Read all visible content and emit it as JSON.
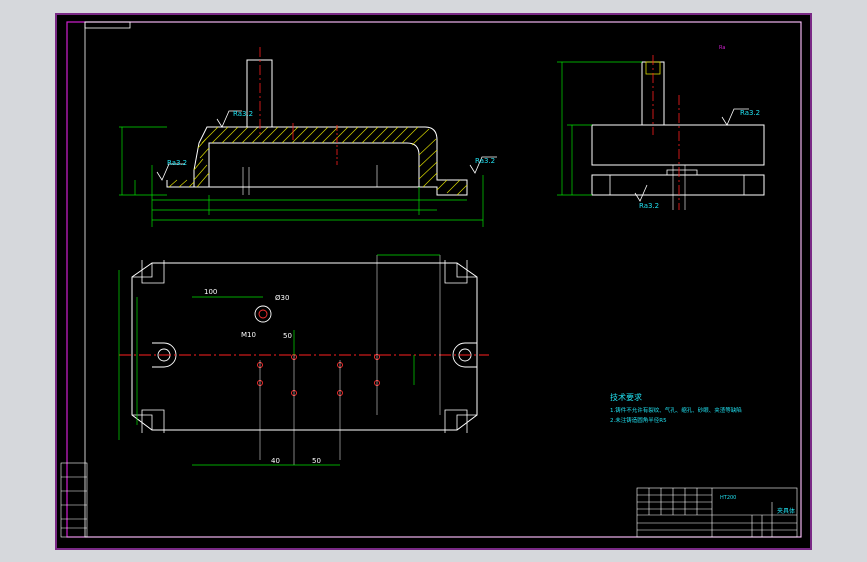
{
  "colors": {
    "background": "#000000",
    "frame": "#d020d0",
    "outline": "#ffffff",
    "dimension": "#00e000",
    "centerline": "#ff2020",
    "hatch": "#d8d800",
    "text_cyan": "#20e0f0",
    "hole": "#ff3030"
  },
  "top_view": {
    "dim_horizontal_1": "100",
    "dim_hole_label": "Ø30",
    "dim_thread_label": "M10",
    "dim_vertical_1": "50",
    "dim_bottom_1": "40",
    "dim_bottom_2": "50"
  },
  "front_view": {
    "roughness_top": "Ra3.2",
    "roughness_left": "Ra3.2",
    "roughness_right": "Ra3.2"
  },
  "side_view": {
    "roughness_top": "Ra3.2",
    "roughness_bottom": "Ra3.2"
  },
  "tech_requirements": {
    "title": "技术要求",
    "line1": "1.铸件不允许有裂纹、气孔、缩孔、砂眼、夹渣等缺陷",
    "line2": "2.未注铸造圆角半径R5"
  },
  "title_block": {
    "drawing_name": "夹具体",
    "material": "HT200"
  }
}
